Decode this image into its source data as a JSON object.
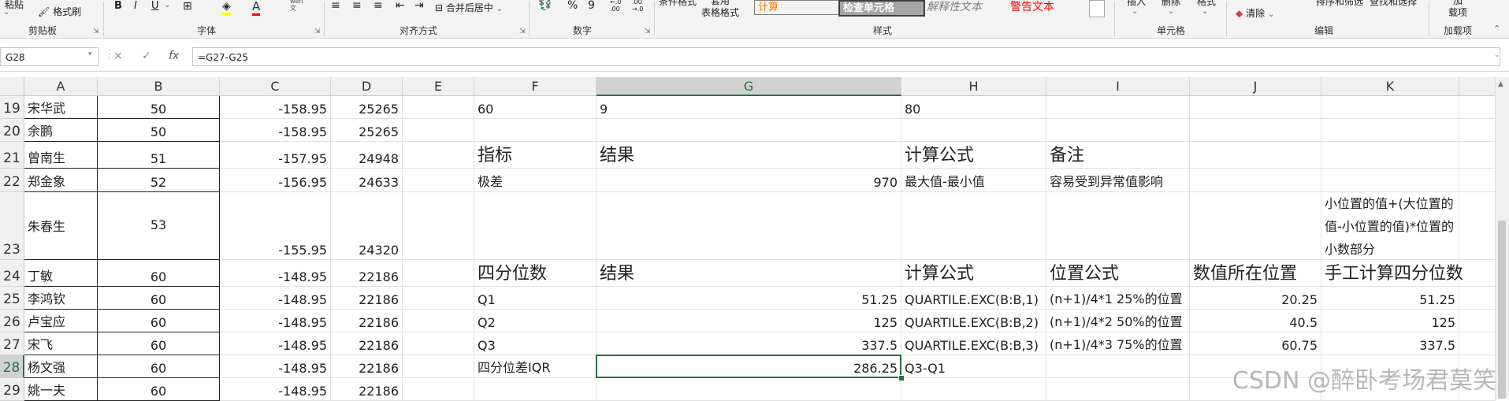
{
  "ribbon": {
    "paste_label": "粘贴",
    "format_painter_label": "格式刷",
    "group_clipboard": "剪贴板",
    "font_buttons": [
      "B",
      "I",
      "U"
    ],
    "group_font": "字体",
    "wen_label": "wén\n文",
    "merge_center_label": "合并后居中",
    "group_alignment": "对齐方式",
    "percent_label": "%",
    "comma_label": "9",
    "dec_inc_label": "←.0\n.00",
    "dec_dec_label": ".00\n→.0",
    "group_number": "数字",
    "cond_format_label": "条件格式",
    "table_format_label": "套用\n表格格式",
    "style_calc": "计算",
    "style_check": "检查单元格",
    "style_explain": "解释性文本",
    "style_warn": "警告文本",
    "group_styles": "样式",
    "insert_label": "插入",
    "delete_label": "删除",
    "format_label": "格式",
    "group_cells": "单元格",
    "clear_label": "清除",
    "sort_filter_label": "排序和筛选",
    "find_select_label": "查找和选择",
    "group_editing": "编辑",
    "addin_label": "加\n载项",
    "group_addins": "加载项"
  },
  "formula_bar": {
    "name_box": "G28",
    "formula": "=G27-G25",
    "cancel_icon": "×",
    "confirm_icon": "✓",
    "fx_label": "fx"
  },
  "columns": [
    "A",
    "B",
    "C",
    "D",
    "E",
    "F",
    "G",
    "H",
    "I",
    "J",
    "K"
  ],
  "rows": [
    {
      "num": "19",
      "A": "宋华武",
      "B": "50",
      "C": "-158.95",
      "D": "25265",
      "F": "60",
      "G": "9",
      "H": "80"
    },
    {
      "num": "20",
      "A": "余鹏",
      "B": "50",
      "C": "-158.95",
      "D": "25265"
    },
    {
      "num": "21",
      "A": "曾南生",
      "B": "51",
      "C": "-157.95",
      "D": "24948",
      "F": "指标",
      "G": "结果",
      "H": "计算公式",
      "I": "备注"
    },
    {
      "num": "22",
      "A": "郑金象",
      "B": "52",
      "C": "-156.95",
      "D": "24633",
      "F": "极差",
      "G": "970",
      "H": "最大值-最小值",
      "I": "容易受到异常值影响"
    },
    {
      "num": "23",
      "A": "朱春生",
      "B": "53",
      "C": "-155.95",
      "D": "24320",
      "K": "小位置的值+(大位置的值-小位置的值)*位置的小数部分"
    },
    {
      "num": "24",
      "A": "丁敏",
      "B": "60",
      "C": "-148.95",
      "D": "22186",
      "F": "四分位数",
      "G": "结果",
      "H": "计算公式",
      "I": "位置公式",
      "J": "数值所在位置",
      "K": "手工计算四分位数"
    },
    {
      "num": "25",
      "A": "李鸿钦",
      "B": "60",
      "C": "-148.95",
      "D": "22186",
      "F": "Q1",
      "G": "51.25",
      "H": "QUARTILE.EXC(B:B,1)",
      "I": "(n+1)/4*1  25%的位置",
      "J": "20.25",
      "K": "51.25"
    },
    {
      "num": "26",
      "A": "卢宝应",
      "B": "60",
      "C": "-148.95",
      "D": "22186",
      "F": "Q2",
      "G": "125",
      "H": "QUARTILE.EXC(B:B,2)",
      "I": "(n+1)/4*2  50%的位置",
      "J": "40.5",
      "K": "125"
    },
    {
      "num": "27",
      "A": "宋飞",
      "B": "60",
      "C": "-148.95",
      "D": "22186",
      "F": "Q3",
      "G": "337.5",
      "H": "QUARTILE.EXC(B:B,3)",
      "I": "(n+1)/4*3  75%的位置",
      "J": "60.75",
      "K": "337.5"
    },
    {
      "num": "28",
      "A": "杨文强",
      "B": "60",
      "C": "-148.95",
      "D": "22186",
      "F": "四分位差IQR",
      "G": "286.25",
      "H": "Q3-Q1"
    },
    {
      "num": "29",
      "A": "姚一夫",
      "B": "60",
      "C": "-148.95",
      "D": "22186"
    }
  ],
  "watermark": "CSDN @醉卧考场君莫笑",
  "colors": {
    "accent": "#217346",
    "header_bg": "#f0f0f0",
    "ribbon_bg": "#f3f3f3"
  }
}
